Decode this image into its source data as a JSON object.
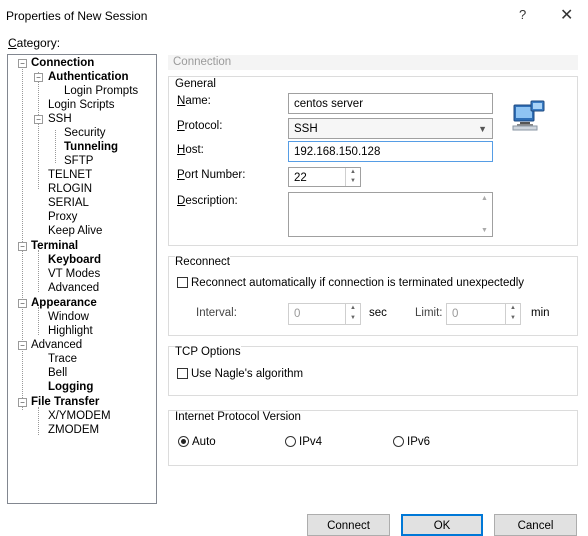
{
  "window": {
    "title": "Properties of New Session",
    "help": "?",
    "close": "✕"
  },
  "category_label": "Category:",
  "tree": [
    {
      "label": "Connection",
      "bold": true
    },
    {
      "label": "Authentication",
      "bold": true
    },
    {
      "label": "Login Prompts",
      "bold": false
    },
    {
      "label": "Login Scripts",
      "bold": false
    },
    {
      "label": "SSH",
      "bold": false
    },
    {
      "label": "Security",
      "bold": false
    },
    {
      "label": "Tunneling",
      "bold": true
    },
    {
      "label": "SFTP",
      "bold": false
    },
    {
      "label": "TELNET",
      "bold": false
    },
    {
      "label": "RLOGIN",
      "bold": false
    },
    {
      "label": "SERIAL",
      "bold": false
    },
    {
      "label": "Proxy",
      "bold": false
    },
    {
      "label": "Keep Alive",
      "bold": false
    },
    {
      "label": "Terminal",
      "bold": true
    },
    {
      "label": "Keyboard",
      "bold": true
    },
    {
      "label": "VT Modes",
      "bold": false
    },
    {
      "label": "Advanced",
      "bold": false
    },
    {
      "label": "Appearance",
      "bold": true
    },
    {
      "label": "Window",
      "bold": false
    },
    {
      "label": "Highlight",
      "bold": false
    },
    {
      "label": "Advanced",
      "bold": false
    },
    {
      "label": "Trace",
      "bold": false
    },
    {
      "label": "Bell",
      "bold": false
    },
    {
      "label": "Logging",
      "bold": true
    },
    {
      "label": "File Transfer",
      "bold": true
    },
    {
      "label": "X/YMODEM",
      "bold": false
    },
    {
      "label": "ZMODEM",
      "bold": false
    }
  ],
  "section_title": "Connection",
  "general": {
    "legend": "General",
    "name_label": "Name:",
    "name_value": "centos server",
    "protocol_label": "Protocol:",
    "protocol_value": "SSH",
    "host_label": "Host:",
    "host_value": "192.168.150.128",
    "port_label": "Port Number:",
    "port_value": "22",
    "description_label": "Description:",
    "description_value": ""
  },
  "reconnect": {
    "legend": "Reconnect",
    "checkbox_label": "Reconnect automatically if connection is terminated unexpectedly",
    "checked": false,
    "interval_label": "Interval:",
    "interval_value": "0",
    "interval_unit": "sec",
    "limit_label": "Limit:",
    "limit_value": "0",
    "limit_unit": "min"
  },
  "tcp": {
    "legend": "TCP Options",
    "nagle_label": "Use Nagle's algorithm",
    "checked": false
  },
  "ip": {
    "legend": "Internet Protocol Version",
    "options": [
      "Auto",
      "IPv4",
      "IPv6"
    ],
    "selected": "Auto"
  },
  "buttons": {
    "connect": "Connect",
    "ok": "OK",
    "cancel": "Cancel"
  },
  "colors": {
    "focus_border": "#569de5",
    "default_button_border": "#0078d7",
    "button_face": "#e1e1e1"
  }
}
